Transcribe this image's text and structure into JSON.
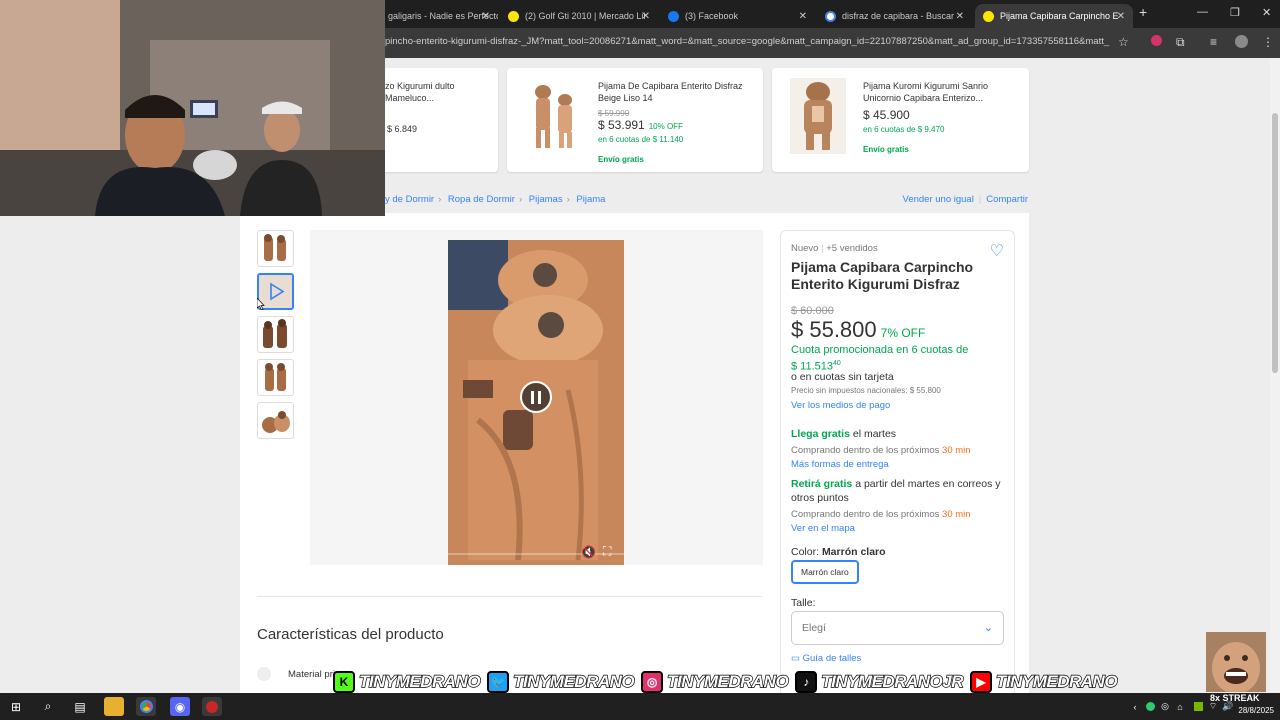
{
  "browser": {
    "tabs": [
      {
        "label": "galigaris - Nadie es Perfecto",
        "icon": "document-icon"
      },
      {
        "label": "(2) Golf Gti 2010 | Mercado Libre",
        "icon": "mercadolibre-icon"
      },
      {
        "label": "(3) Facebook",
        "icon": "facebook-icon"
      },
      {
        "label": "disfraz de capibara - Buscar con Google",
        "icon": "google-icon"
      },
      {
        "label": "Pijama Capibara Carpincho Enterito",
        "icon": "mercadolibre-icon"
      }
    ],
    "url": "pincho-enterito-kigurumi-disfraz-_JM?matt_tool=20086271&matt_word=&matt_source=google&matt_campaign_id=22107887250&matt_ad_group_id=173357558116&matt_..."
  },
  "recommendations": [
    {
      "title": "zo Kigurumi dulto Mameluco...",
      "old_price": "",
      "price": "$ 6.849",
      "off": "",
      "cuotas": "",
      "shipping": ""
    },
    {
      "title": "Pijama De Capibara Enterito Disfraz Beige Liso 14",
      "old_price": "$ 59.990",
      "price": "$ 53.991",
      "off": "10% OFF",
      "cuotas": "en 6 cuotas de $ 11.140",
      "shipping": "Envío gratis"
    },
    {
      "title": "Pijama Kuromi Kigurumi Sanrio Unicornio Capibara Enterizo...",
      "old_price": "",
      "price": "$ 45.900",
      "off": "",
      "cuotas": "en 6 cuotas de $ 9.470",
      "shipping": "Envío gratis"
    }
  ],
  "breadcrumb": [
    "y de Dormir",
    "Ropa de Dormir",
    "Pijamas",
    "Pijama"
  ],
  "actions": {
    "sell": "Vender uno igual",
    "share": "Compartir"
  },
  "product": {
    "condition": "Nuevo",
    "sold": "+5 vendidos",
    "title": "Pijama Capibara Carpincho Enterito Kigurumi Disfraz",
    "old_price": "$ 60.000",
    "price": "$ 55.800",
    "off": "7% OFF",
    "promo_line1": "Cuota promocionada en 6 cuotas de",
    "promo_line2": "$ 11.513",
    "promo_cents": "40",
    "no_card": "o en cuotas sin tarjeta",
    "tax_note": "Precio sin impuestos nacionales: $ 55.800",
    "payment_link": "Ver los medios de pago",
    "delivery_green": "Llega gratis",
    "delivery_rest": " el martes",
    "buy_within": "Comprando dentro de los próximos ",
    "buy_time": "30 min",
    "more_delivery": "Más formas de entrega",
    "pickup_green": "Retirá gratis",
    "pickup_rest": " a partir del martes en correos y otros puntos",
    "map_link": "Ver en el mapa",
    "color_label": "Color: ",
    "color_value": "Marrón claro",
    "color_chip": "Marrón claro",
    "size_label": "Talle:",
    "size_placeholder": "Elegí",
    "size_guide": "Guía de talles"
  },
  "characteristics": {
    "title": "Características del producto",
    "first_row": "Material pri"
  },
  "overlay": {
    "socials": [
      {
        "icon": "kick-icon",
        "name": "TINYMEDRANO",
        "color": "#53fc18"
      },
      {
        "icon": "twitter-icon",
        "name": "TINYMEDRANO",
        "color": "#1da1f2"
      },
      {
        "icon": "instagram-icon",
        "name": "TINYMEDRANO",
        "color": "#e1306c"
      },
      {
        "icon": "tiktok-icon",
        "name": "TINYMEDRANOJR",
        "color": "#111111"
      },
      {
        "icon": "youtube-icon",
        "name": "TINYMEDRANO",
        "color": "#ff0000"
      }
    ],
    "streak": "8x STREAK"
  },
  "taskbar": {
    "date": "28/8/2025"
  },
  "colors": {
    "accent": "#3483fa",
    "green": "#00a650",
    "orange": "#f37121"
  }
}
